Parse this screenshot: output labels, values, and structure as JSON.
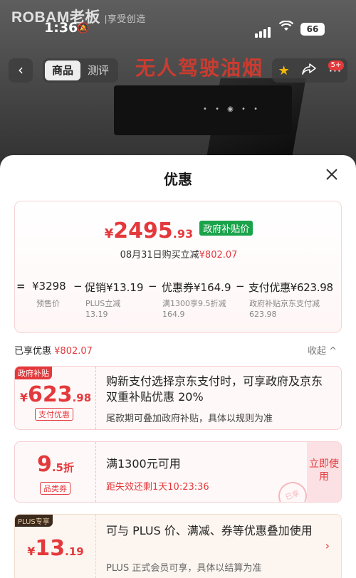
{
  "status": {
    "time": "1:36",
    "battery": "66"
  },
  "background": {
    "logo": "ROBAM老板",
    "logo_slogan": "|享受创造",
    "promo": "无人驾驶油烟"
  },
  "nav": {
    "back_icon": "chevron-left",
    "tabs": [
      {
        "label": "商品",
        "active": true
      },
      {
        "label": "测评",
        "active": false
      }
    ],
    "badge": "5+"
  },
  "sheet": {
    "title": "优惠",
    "price": {
      "currency": "¥",
      "integer": "2495",
      "decimal": ".93",
      "tag": "政府补贴价"
    },
    "date_line": {
      "text": "08月31日购买立减",
      "amount": "¥802.07"
    },
    "formula": {
      "eq": "=",
      "base": {
        "value": "¥3298",
        "label": "预售价"
      },
      "minus1": "−",
      "promo": {
        "value": "促销¥13.19",
        "label1": "PLUS立减",
        "label2": "13.19"
      },
      "minus2": "−",
      "coupon": {
        "value": "优惠券¥164.9",
        "label1": "满1300享9.5折减",
        "label2": "164.9"
      },
      "minus3": "−",
      "pay": {
        "value": "支付优惠¥623.98",
        "label1": "政府补贴京东支付减",
        "label2": "623.98"
      }
    },
    "enjoyed": {
      "label": "已享优惠",
      "amount": "¥802.07"
    },
    "collapse": "收起 ^",
    "coupons": [
      {
        "tag": "政府补贴",
        "currency": "¥",
        "integer": "623",
        "decimal": ".98",
        "sub": "支付优惠",
        "title": "购新支付选择京东支付时，可享政府及京东双重补贴优惠 20%",
        "desc": "尾款期可叠加政府补贴，具体以规则为准"
      },
      {
        "integer": "9",
        "decimal": ".5折",
        "sub": "品类券",
        "title": "满1300元可用",
        "desc": "距失效还剩1天10:23:36",
        "use": "立即使用",
        "stamp": "已享"
      },
      {
        "tag": "PLUS专享",
        "currency": "¥",
        "integer": "13",
        "decimal": ".19",
        "title": "可与 PLUS 价、满减、券等优惠叠加使用",
        "desc": "PLUS 正式会员可享，具体以结算为准",
        "chevron": "›"
      }
    ]
  }
}
